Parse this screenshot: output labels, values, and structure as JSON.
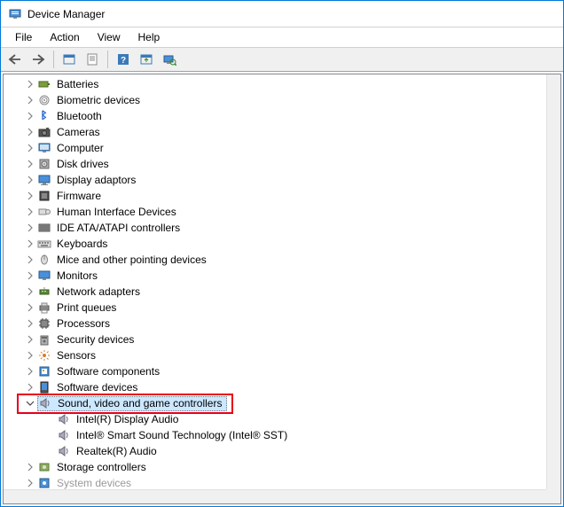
{
  "window": {
    "title": "Device Manager"
  },
  "menu": {
    "file": "File",
    "action": "Action",
    "view": "View",
    "help": "Help"
  },
  "toolbar_icons": [
    "back",
    "forward",
    "sep",
    "show-hidden",
    "properties",
    "sep",
    "help",
    "update",
    "scan"
  ],
  "tree": {
    "items": [
      {
        "label": "Batteries",
        "icon": "battery",
        "expanded": false
      },
      {
        "label": "Biometric devices",
        "icon": "fingerprint",
        "expanded": false
      },
      {
        "label": "Bluetooth",
        "icon": "bluetooth",
        "expanded": false
      },
      {
        "label": "Cameras",
        "icon": "camera",
        "expanded": false
      },
      {
        "label": "Computer",
        "icon": "computer",
        "expanded": false
      },
      {
        "label": "Disk drives",
        "icon": "disk",
        "expanded": false
      },
      {
        "label": "Display adaptors",
        "icon": "display",
        "expanded": false
      },
      {
        "label": "Firmware",
        "icon": "firmware",
        "expanded": false
      },
      {
        "label": "Human Interface Devices",
        "icon": "hid",
        "expanded": false
      },
      {
        "label": "IDE ATA/ATAPI controllers",
        "icon": "ide",
        "expanded": false
      },
      {
        "label": "Keyboards",
        "icon": "keyboard",
        "expanded": false
      },
      {
        "label": "Mice and other pointing devices",
        "icon": "mouse",
        "expanded": false
      },
      {
        "label": "Monitors",
        "icon": "monitor",
        "expanded": false
      },
      {
        "label": "Network adapters",
        "icon": "network",
        "expanded": false
      },
      {
        "label": "Print queues",
        "icon": "printer",
        "expanded": false
      },
      {
        "label": "Processors",
        "icon": "cpu",
        "expanded": false
      },
      {
        "label": "Security devices",
        "icon": "security",
        "expanded": false
      },
      {
        "label": "Sensors",
        "icon": "sensor",
        "expanded": false
      },
      {
        "label": "Software components",
        "icon": "swcomp",
        "expanded": false
      },
      {
        "label": "Software devices",
        "icon": "swdev",
        "expanded": false
      },
      {
        "label": "Sound, video and game controllers",
        "icon": "sound",
        "expanded": true,
        "selected": true,
        "children": [
          {
            "label": "Intel(R) Display Audio",
            "icon": "sound"
          },
          {
            "label": "Intel® Smart Sound Technology (Intel® SST)",
            "icon": "sound"
          },
          {
            "label": "Realtek(R) Audio",
            "icon": "sound"
          }
        ]
      },
      {
        "label": "Storage controllers",
        "icon": "storage",
        "expanded": false
      },
      {
        "label": "System devices",
        "icon": "system",
        "expanded": false,
        "cutoff": true
      }
    ]
  }
}
